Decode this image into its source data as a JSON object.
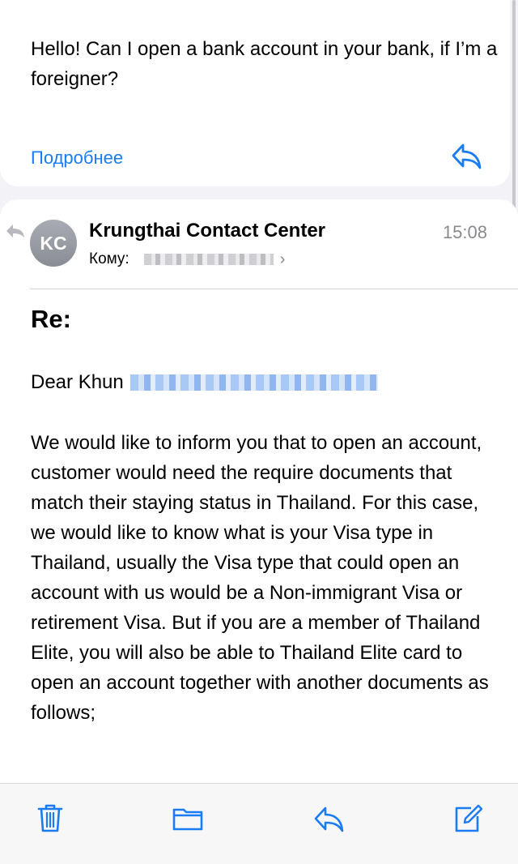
{
  "previous_message": {
    "text": "Hello! Can I open a bank account in your bank, if I’m a foreigner?",
    "more_label": "Подробнее",
    "reply_icon": "reply-icon"
  },
  "message": {
    "avatar_initials": "KC",
    "sender": "Krungthai Contact Center",
    "time": "15:08",
    "to_label": "Кому:",
    "subject": "Re:",
    "greeting": "Dear Khun",
    "body": "We would like to inform you that to open an account, customer would need the require documents that match their staying status in Thailand. For this case, we would like to know what is your Visa type in Thailand, usually the Visa type that could open an account with us would be a Non-immigrant Visa or retirement Visa. But if you are a member of Thailand Elite, you will also be able to Thailand Elite card to open an account together with another documents as follows;"
  },
  "toolbar": {
    "items": [
      "trash-icon",
      "folder-icon",
      "reply-icon",
      "compose-icon"
    ]
  },
  "colors": {
    "accent": "#1a7cf5",
    "secondary_text": "#8a8a8e",
    "background": "#f2f2f7"
  }
}
